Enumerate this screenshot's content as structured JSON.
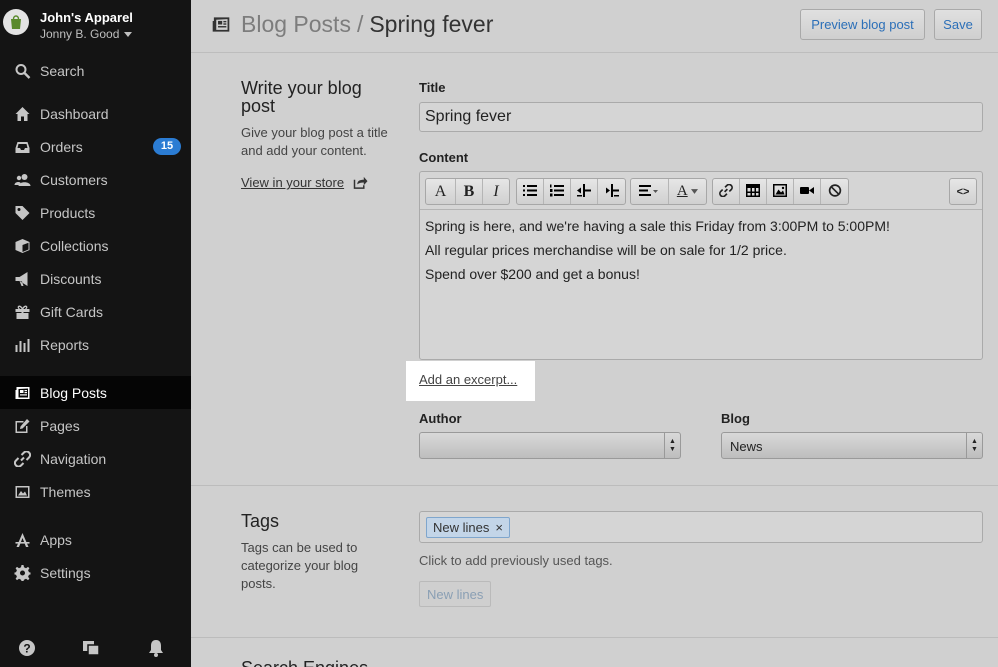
{
  "store": {
    "name": "John's Apparel",
    "user": "Jonny B. Good"
  },
  "sidebar": {
    "search_label": "Search",
    "items": [
      {
        "label": "Dashboard",
        "icon": "home-icon"
      },
      {
        "label": "Orders",
        "icon": "inbox-icon",
        "badge": "15"
      },
      {
        "label": "Customers",
        "icon": "users-icon"
      },
      {
        "label": "Products",
        "icon": "tag-icon"
      },
      {
        "label": "Collections",
        "icon": "box-icon"
      },
      {
        "label": "Discounts",
        "icon": "megaphone-icon"
      },
      {
        "label": "Gift Cards",
        "icon": "gift-icon"
      },
      {
        "label": "Reports",
        "icon": "bar-chart-icon"
      },
      {
        "label": "Blog Posts",
        "icon": "newspaper-icon",
        "active": true
      },
      {
        "label": "Pages",
        "icon": "edit-icon"
      },
      {
        "label": "Navigation",
        "icon": "link-icon"
      },
      {
        "label": "Themes",
        "icon": "image-icon"
      },
      {
        "label": "Apps",
        "icon": "apps-icon"
      },
      {
        "label": "Settings",
        "icon": "gear-icon"
      }
    ]
  },
  "header": {
    "breadcrumb_parent": "Blog Posts",
    "breadcrumb_separator": "/",
    "breadcrumb_current": "Spring fever",
    "preview_label": "Preview blog post",
    "save_label": "Save"
  },
  "write_section": {
    "title": "Write your blog post",
    "desc": "Give your blog post a title and add your content.",
    "view_link": "View in your store"
  },
  "form": {
    "title_label": "Title",
    "title_value": "Spring fever",
    "content_label": "Content",
    "content_lines": [
      "Spring is here, and we're having a sale this Friday from 3:00PM to 5:00PM!",
      "All regular prices merchandise will be on sale for 1/2 price.",
      "Spend over $200 and get a bonus!"
    ],
    "excerpt_link": "Add an excerpt...",
    "author_label": "Author",
    "author_value": "",
    "blog_label": "Blog",
    "blog_value": "News"
  },
  "toolbar": {
    "font_label": "A",
    "bold_label": "B",
    "italic_label": "I",
    "color_label": "A",
    "html_label": "<>"
  },
  "tags_section": {
    "title": "Tags",
    "desc": "Tags can be used to categorize your blog posts.",
    "tag_chips": [
      "New lines"
    ],
    "remove_glyph": "×",
    "helper_text": "Click to add previously used tags.",
    "previous_tags": [
      "New lines"
    ]
  },
  "seo_section": {
    "title": "Search Engines"
  },
  "colors": {
    "sidebar_bg": "#141414",
    "accent": "#2b7cd3",
    "link": "#2b6fb8"
  }
}
